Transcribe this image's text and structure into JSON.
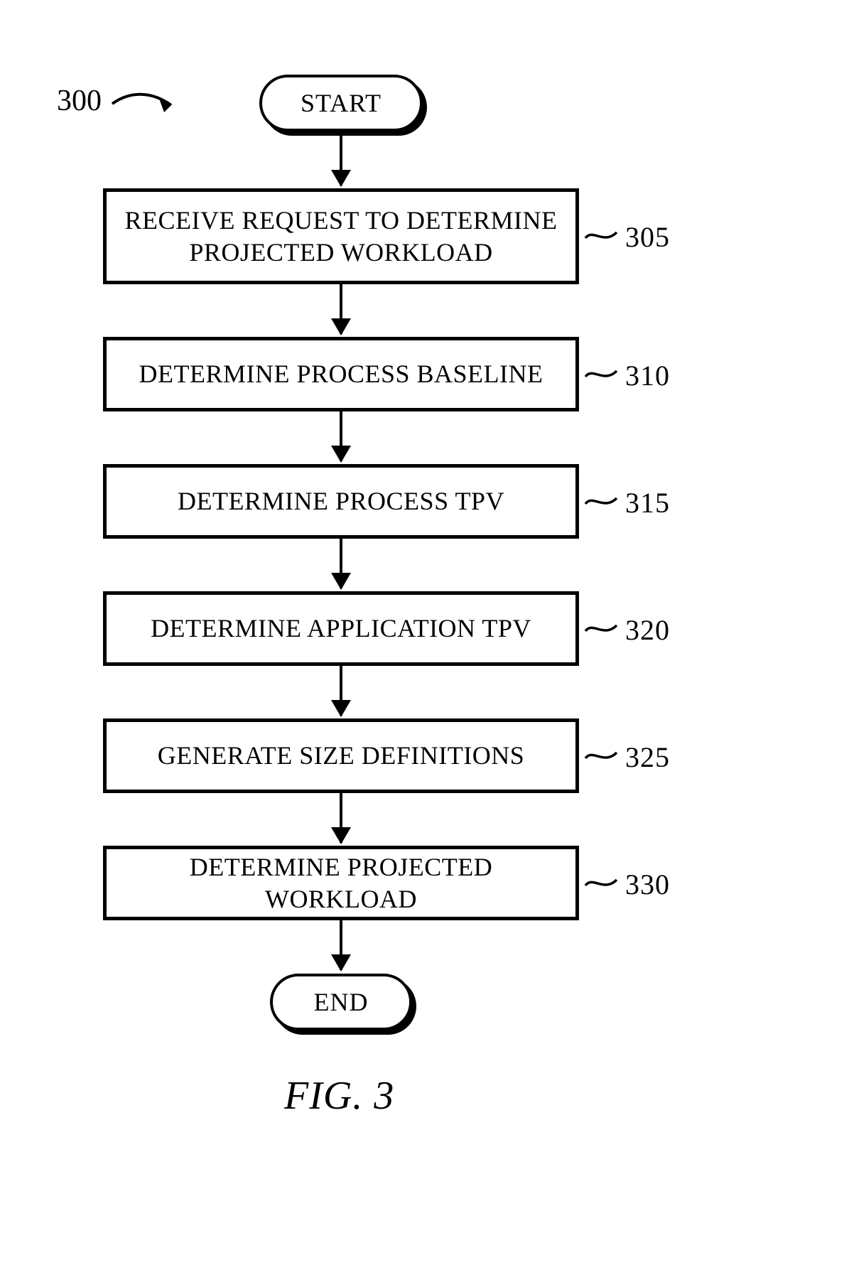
{
  "figure": {
    "ref_label": "300",
    "start": "START",
    "end": "END",
    "caption": "FIG. 3",
    "steps": [
      {
        "id": "305",
        "text": "RECEIVE REQUEST TO DETERMINE PROJECTED WORKLOAD"
      },
      {
        "id": "310",
        "text": "DETERMINE PROCESS BASELINE"
      },
      {
        "id": "315",
        "text": "DETERMINE PROCESS TPV"
      },
      {
        "id": "320",
        "text": "DETERMINE APPLICATION TPV"
      },
      {
        "id": "325",
        "text": "GENERATE SIZE DEFINITIONS"
      },
      {
        "id": "330",
        "text": "DETERMINE PROJECTED WORKLOAD"
      }
    ]
  }
}
